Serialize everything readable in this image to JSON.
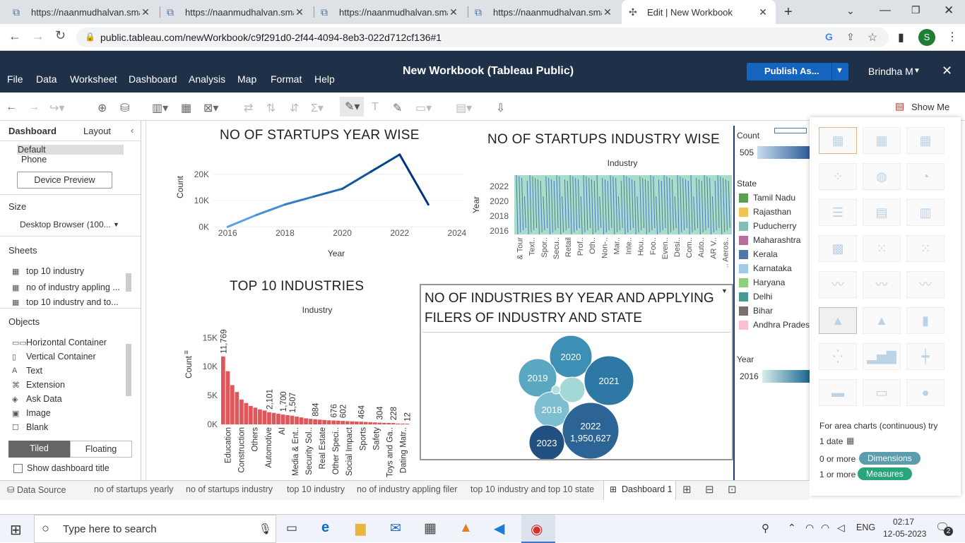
{
  "browser": {
    "tabs": [
      {
        "title": "https://naanmudhalvan.smar",
        "active": false
      },
      {
        "title": "https://naanmudhalvan.smar",
        "active": false
      },
      {
        "title": "https://naanmudhalvan.smar",
        "active": false
      },
      {
        "title": "https://naanmudhalvan.smar",
        "active": false
      },
      {
        "title": "Edit | New Workbook",
        "active": true
      }
    ],
    "url": "public.tableau.com/newWorkbook/c9f291d0-2f44-4094-8eb3-022d712cf136#1",
    "profile_initial": "S"
  },
  "app": {
    "title": "New Workbook (Tableau Public)",
    "menu": [
      "File",
      "Data",
      "Worksheet",
      "Dashboard",
      "Analysis",
      "Map",
      "Format",
      "Help"
    ],
    "publish_label": "Publish As...",
    "user": "Brindha M"
  },
  "toolbar": {
    "show_me": "Show Me"
  },
  "left_panel": {
    "tab_dashboard": "Dashboard",
    "tab_layout": "Layout",
    "devices": [
      "Default",
      "Phone"
    ],
    "device_preview": "Device Preview",
    "size_label": "Size",
    "size_value": "Desktop Browser (100...",
    "sheets_label": "Sheets",
    "sheets": [
      "top 10 industry",
      "no of industry appling ...",
      "top 10 industry and to..."
    ],
    "objects_label": "Objects",
    "objects": [
      {
        "label": "Horizontal Container",
        "icon": "horizontal-container-icon",
        "glyph": "▭▭"
      },
      {
        "label": "Vertical Container",
        "icon": "vertical-container-icon",
        "glyph": "▯"
      },
      {
        "label": "Text",
        "icon": "text-icon",
        "glyph": "A"
      },
      {
        "label": "Extension",
        "icon": "extension-icon",
        "glyph": "⌘"
      },
      {
        "label": "Ask Data",
        "icon": "ask-data-icon",
        "glyph": "◈"
      },
      {
        "label": "Image",
        "icon": "image-icon",
        "glyph": "▣"
      },
      {
        "label": "Blank",
        "icon": "blank-icon",
        "glyph": "☐"
      }
    ],
    "tiled": "Tiled",
    "floating": "Floating",
    "show_title": "Show dashboard title"
  },
  "charts": {
    "yearwise_title": "NO OF STARTUPS YEAR WISE",
    "industry_title": "NO OF STARTUPS INDUSTRY WISE",
    "top10_title": "TOP 10 INDUSTRIES",
    "bubble_title_1": "NO OF INDUSTRIES BY YEAR AND APPLYING",
    "bubble_title_2": "FILERS OF INDUSTRY AND STATE"
  },
  "chart_data": [
    {
      "type": "line",
      "title": "NO OF STARTUPS YEAR WISE",
      "xlabel": "Year",
      "ylabel": "Count",
      "x": [
        2016,
        2017,
        2018,
        2019,
        2020,
        2021,
        2022,
        2023
      ],
      "values": [
        0,
        4500,
        8500,
        11500,
        14500,
        21000,
        27500,
        8500
      ],
      "xticks": [
        "2016",
        "2018",
        "2020",
        "2022",
        "2024"
      ],
      "yticks": [
        "0K",
        "10K",
        "20K"
      ],
      "xlim": [
        2015.5,
        2024.2
      ],
      "ylim": [
        -1000,
        28000
      ]
    },
    {
      "type": "area",
      "title": "NO OF STARTUPS INDUSTRY WISE",
      "xlabel": "Industry",
      "ylabel": "Year",
      "yticks": [
        "2016",
        "2018",
        "2020",
        "2022"
      ],
      "categories": [
        "& Tour",
        "Text..",
        "Spor..",
        "Secu..",
        "Retail",
        "Prof..",
        "Oth..",
        "Non-..",
        "Mar..",
        "Inte..",
        "Hou..",
        "Foo..",
        "Even..",
        "Desi..",
        "Com..",
        "Auto..",
        "AR V..",
        "Airp.. Aeros.."
      ]
    },
    {
      "type": "bar",
      "title": "TOP 10 INDUSTRIES",
      "xlabel": "Industry",
      "ylabel": "Count",
      "yticks": [
        "0K",
        "5K",
        "10K",
        "15K"
      ],
      "ylim": [
        0,
        16500
      ],
      "values": [
        11769,
        9200,
        6800,
        5600,
        4300,
        3700,
        3200,
        2900,
        2600,
        2400,
        2101,
        2000,
        1850,
        1700,
        1600,
        1507,
        1350,
        1200,
        1050,
        950,
        884,
        820,
        760,
        700,
        676,
        640,
        602,
        560,
        520,
        490,
        464,
        420,
        380,
        340,
        304,
        270,
        250,
        228,
        150,
        80,
        12
      ],
      "labeled": [
        {
          "index": 0,
          "label": "11,769"
        },
        {
          "index": 10,
          "label": "2,101"
        },
        {
          "index": 13,
          "label": "1,700"
        },
        {
          "index": 15,
          "label": "1,507"
        },
        {
          "index": 20,
          "label": "884"
        },
        {
          "index": 24,
          "label": "676"
        },
        {
          "index": 26,
          "label": "602"
        },
        {
          "index": 30,
          "label": "464"
        },
        {
          "index": 34,
          "label": "304"
        },
        {
          "index": 37,
          "label": "228"
        },
        {
          "index": 40,
          "label": "12"
        }
      ],
      "xticks": [
        "Education",
        "Construction",
        "Others",
        "Automotive",
        "AI",
        "Media & Ent..",
        "Security Sol..",
        "Real Estate",
        "Other Speci..",
        "Social Impact",
        "Sports",
        "Safety",
        "Toys and Ga..",
        "Dating Matr.."
      ]
    },
    {
      "type": "bubble",
      "title": "NO OF INDUSTRIES BY YEAR AND APPLYING FILERS OF INDUSTRY AND STATE",
      "bubbles": [
        {
          "label": "2020",
          "color": "#3e8fb5"
        },
        {
          "label": "2021",
          "color": "#2e78a6"
        },
        {
          "label": "2019",
          "color": "#5aa7c2"
        },
        {
          "label": "2018",
          "color": "#7dbfd0"
        },
        {
          "label": "2022",
          "value": "1,950,627",
          "color": "#2b6495"
        },
        {
          "label": "2023",
          "color": "#214f80"
        },
        {
          "label": "",
          "color": "#a4d8d6"
        },
        {
          "label": "",
          "color": "#b5e0db"
        }
      ]
    }
  ],
  "legend": {
    "count_label": "Count",
    "count_min": "505",
    "state_label": "State",
    "states": [
      {
        "name": "Tamil Nadu",
        "color": "#59a14f"
      },
      {
        "name": "Rajasthan",
        "color": "#f1c453"
      },
      {
        "name": "Puducherry",
        "color": "#86bcb6"
      },
      {
        "name": "Maharashtra",
        "color": "#b86c9c"
      },
      {
        "name": "Kerala",
        "color": "#4e79a7"
      },
      {
        "name": "Karnataka",
        "color": "#a0cbe8"
      },
      {
        "name": "Haryana",
        "color": "#8cd17d"
      },
      {
        "name": "Delhi",
        "color": "#499894"
      },
      {
        "name": "Bihar",
        "color": "#79706e"
      },
      {
        "name": "Andhra Prades",
        "color": "#fabfd2"
      }
    ],
    "year_label": "Year",
    "year_min": "2016"
  },
  "show_me": {
    "hint_prefix": "For area charts (continuous) try",
    "date_line": "1 date",
    "dim_prefix": "0 or more",
    "dimensions": "Dimensions",
    "meas_prefix": "1 or more",
    "measures": "Measures"
  },
  "sheet_tabs": {
    "data_source": "Data Source",
    "tabs": [
      "no of startups yearly",
      "no of startups industry",
      "top 10 industry",
      "no of industry appling filer",
      "top 10 industry and top 10 state",
      "Dashboard 1"
    ]
  },
  "taskbar": {
    "search_placeholder": "Type here to search",
    "lang": "ENG",
    "time": "02:17",
    "date": "12-05-2023",
    "notifications": "2"
  }
}
